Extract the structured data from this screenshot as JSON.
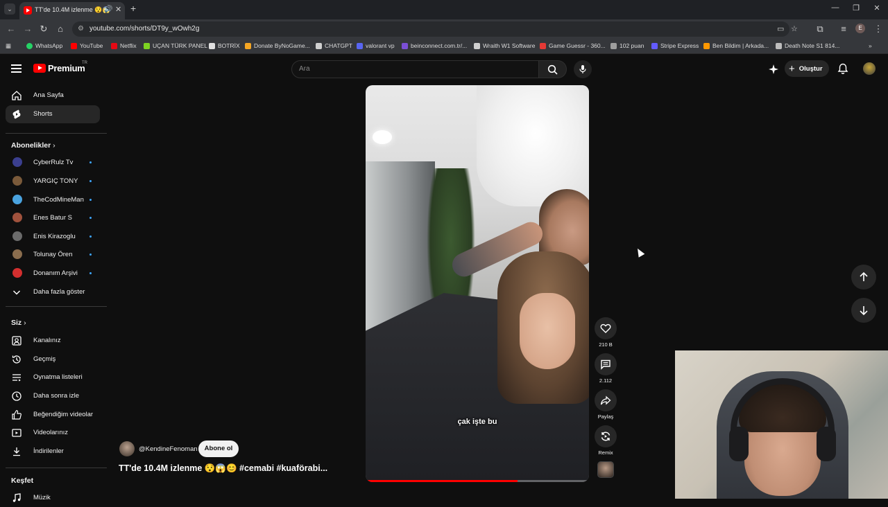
{
  "browser": {
    "tab": {
      "title": "TT'de 10.4M izlenme 😯😱"
    },
    "address": {
      "url": "youtube.com/shorts/DT9y_wOwh2g"
    },
    "bookmarks": [
      {
        "label": "WhatsApp",
        "color": "#25d366"
      },
      {
        "label": "YouTube",
        "color": "#ff0000"
      },
      {
        "label": "Netflix",
        "color": "#e50914"
      },
      {
        "label": "UÇAN TÜRK PANEL",
        "color": "#7dd321"
      },
      {
        "label": "BOTRİX",
        "color": "#e0e0e0"
      },
      {
        "label": "Donate ByNoGame...",
        "color": "#f5a623"
      },
      {
        "label": "CHATGPT",
        "color": "#d0d0d0"
      },
      {
        "label": "valorant vp",
        "color": "#5865f2"
      },
      {
        "label": "beinconnect.com.tr/...",
        "color": "#7b4fd6"
      },
      {
        "label": "Wraith W1 Software",
        "color": "#cfcfcf"
      },
      {
        "label": "Game Guessr - 360...",
        "color": "#e53935"
      },
      {
        "label": "102 puan",
        "color": "#9e9e9e"
      },
      {
        "label": "Stripe Express",
        "color": "#635bff"
      },
      {
        "label": "Ben Bildim | Arkada...",
        "color": "#ff9800"
      },
      {
        "label": "Death Note S1 814...",
        "color": "#bdbdbd"
      }
    ]
  },
  "header": {
    "logo": "Premium",
    "logo_region": "TR",
    "search_placeholder": "Ara",
    "create_label": "Oluştur"
  },
  "sidebar": {
    "main": [
      {
        "label": "Ana Sayfa",
        "active": false
      },
      {
        "label": "Shorts",
        "active": true
      }
    ],
    "subscriptions_title": "Abonelikler",
    "subscriptions": [
      {
        "label": "CyberRulz Tv",
        "color": "#3b3f8f"
      },
      {
        "label": "YARGIÇ TONY",
        "color": "#7a5a3a"
      },
      {
        "label": "TheCodMineMan",
        "color": "#4aa3df"
      },
      {
        "label": "Enes Batur S",
        "color": "#a0523d"
      },
      {
        "label": "Enis Kirazoglu",
        "color": "#6b6b6b"
      },
      {
        "label": "Tolunay Ören",
        "color": "#8a6d4e"
      },
      {
        "label": "Donanım Arşivi",
        "color": "#d32f2f"
      }
    ],
    "show_more": "Daha fazla göster",
    "you_title": "Siz",
    "you": [
      {
        "label": "Kanalınız"
      },
      {
        "label": "Geçmiş"
      },
      {
        "label": "Oynatma listeleri"
      },
      {
        "label": "Daha sonra izle"
      },
      {
        "label": "Beğendiğim videolar"
      },
      {
        "label": "Videolarınız"
      },
      {
        "label": "İndirilenler"
      }
    ],
    "explore_title": "Keşfet",
    "explore": [
      {
        "label": "Müzik"
      }
    ]
  },
  "short": {
    "caption": "çak işte bu",
    "channel": "@KendineFenoman",
    "subscribe_label": "Abone ol",
    "title": "TT'de 10.4M izlenme 😯😱😊 #cemabi #kuaförabi...",
    "progress": 0.68,
    "actions": {
      "likes": "210 B",
      "comments": "2.112",
      "share": "Paylaş",
      "remix": "Remix"
    }
  }
}
